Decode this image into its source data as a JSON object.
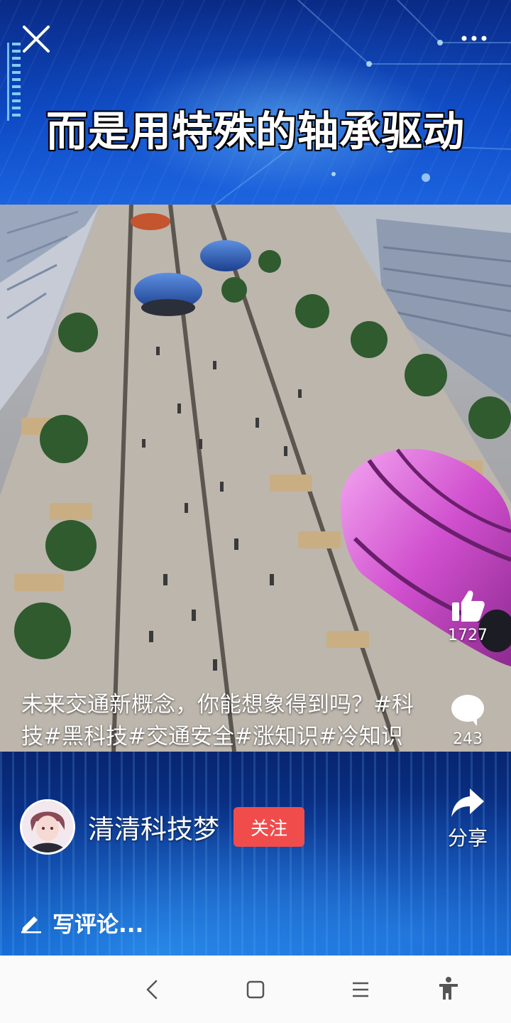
{
  "video": {
    "subtitle": "而是用特殊的轴承驱动"
  },
  "post": {
    "caption": "未来交通新概念，你能想象得到吗？#科技#黑科技#交通安全#涨知识#冷知识",
    "author_name": "清清科技梦",
    "follow_label": "关注"
  },
  "actions": {
    "like_count": "1727",
    "comment_count": "243",
    "share_label": "分享"
  },
  "comment_bar": {
    "placeholder": "写评论..."
  },
  "icons": {
    "close": "close-icon",
    "more": "more-dots-icon",
    "like": "thumbs-up-icon",
    "comment": "comment-bubble-icon",
    "share": "share-arrow-icon",
    "edit": "pencil-icon",
    "nav_back": "back-chevron-icon",
    "nav_home": "home-square-icon",
    "nav_menu": "menu-lines-icon",
    "nav_accessibility": "accessibility-icon"
  },
  "colors": {
    "follow_button": "#f04c4c",
    "background_blue": "#0b3aa5",
    "navbar": "#fafafa"
  }
}
